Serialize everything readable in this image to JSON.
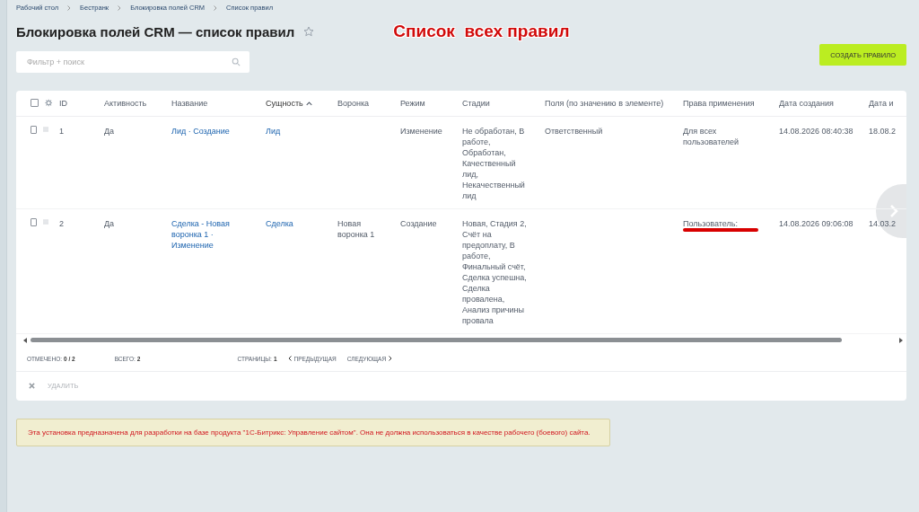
{
  "breadcrumbs": [
    "Рабочий стол",
    "Бестранк",
    "Блокировка полей CRM",
    "Список правил"
  ],
  "title": "Блокировка полей CRM — список правил",
  "favorite": false,
  "annotation": "Список  всех правил",
  "filter": {
    "placeholder": "Фильтр + поиск"
  },
  "create_button": "СОЗДАТЬ ПРАВИЛО",
  "table": {
    "all_checked": false,
    "columns": [
      {
        "label": "ID",
        "sorted": false
      },
      {
        "label": "Активность",
        "sorted": false
      },
      {
        "label": "Название",
        "sorted": false
      },
      {
        "label": "Сущность",
        "sorted": true
      },
      {
        "label": "Воронка",
        "sorted": false
      },
      {
        "label": "Режим",
        "sorted": false
      },
      {
        "label": "Стадии",
        "sorted": false
      },
      {
        "label": "Поля (по значению в элементе)",
        "sorted": false
      },
      {
        "label": "Права применения",
        "sorted": false
      },
      {
        "label": "Дата создания",
        "sorted": false
      },
      {
        "label": "Дата и",
        "sorted": false
      }
    ],
    "rows": [
      {
        "checked": false,
        "cells": [
          "1",
          "Да",
          "Лид · Создание",
          "Лид",
          "",
          "Изменение",
          "Не обработан, В работе, Обработан, Качественный лид, Некачественный лид",
          "Ответственный",
          "Для всех пользователей",
          "14.08.2026 08:40:38",
          "18.08.2"
        ],
        "redacted": false
      },
      {
        "checked": false,
        "cells": [
          "2",
          "Да",
          "Сделка - Новая воронка 1 · Изменение",
          "Сделка",
          "Новая воронка 1",
          "Создание",
          "Новая, Стадия 2, Счёт на предоплату, В работе, Финальный счёт, Сделка успешна, Сделка провалена, Анализ причины провала",
          "",
          "Пользователь:",
          "14.08.2026 09:06:08",
          "14.03.2"
        ],
        "redacted": true
      }
    ]
  },
  "footer": {
    "checked_label": "ОТМЕЧЕНО:",
    "checked_value": "0 / 2",
    "total_label": "ВСЕГО:",
    "total_value": "2",
    "pages_label": "СТРАНИЦЫ:",
    "page": "1",
    "prev": "ПРЕДЫДУЩАЯ",
    "next": "СЛЕДУЮЩАЯ"
  },
  "delete_button": {
    "label": "УДАЛИТЬ",
    "disabled": true
  },
  "warning": "Эта установка предназначена для разработки на базе продукта \"1С-Битрикс: Управление сайтом\". Она не должна использоваться в качестве рабочего (боевого) сайта."
}
